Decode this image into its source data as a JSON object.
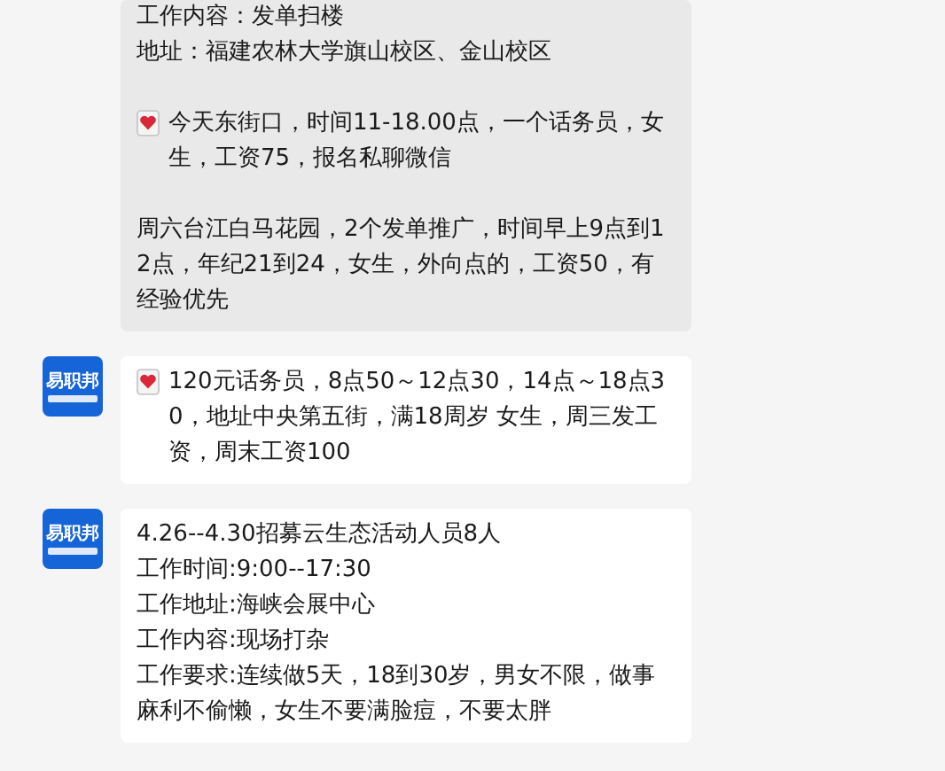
{
  "messages": [
    {
      "highlighted": true,
      "sections": [
        {
          "lines": [
            "工作内容：发单扫楼",
            "地址：福建农林大学旗山校区、金山校区"
          ]
        },
        {
          "heart": true,
          "lines": [
            "今天东街口，时间11-18.00点，一个话务员，女生，工资75，报名私聊微信"
          ]
        },
        {
          "lines": [
            "周六台江白马花园，2个发单推广，时间早上9点到12点，年纪21到24，女生，外向点的，工资50，有经验优先"
          ]
        }
      ]
    },
    {
      "highlighted": false,
      "avatar": {
        "label": "易职邦"
      },
      "sections": [
        {
          "heart": true,
          "lines": [
            "120元话务员，8点50～12点30，14点～18点30，地址中央第五街，满18周岁 女生，周三发工资，周末工资100"
          ]
        }
      ]
    },
    {
      "highlighted": false,
      "avatar": {
        "label": "易职邦"
      },
      "sections": [
        {
          "lines": [
            "4.26--4.30招募云生态活动人员8人",
            "工作时间:9:00--17:30",
            "工作地址:海峡会展中心",
            "工作内容:现场打杂",
            "工作要求:连续做5天，18到30岁，男女不限，做事麻利不偷懒，女生不要满脸痘，不要太胖"
          ]
        }
      ]
    }
  ]
}
